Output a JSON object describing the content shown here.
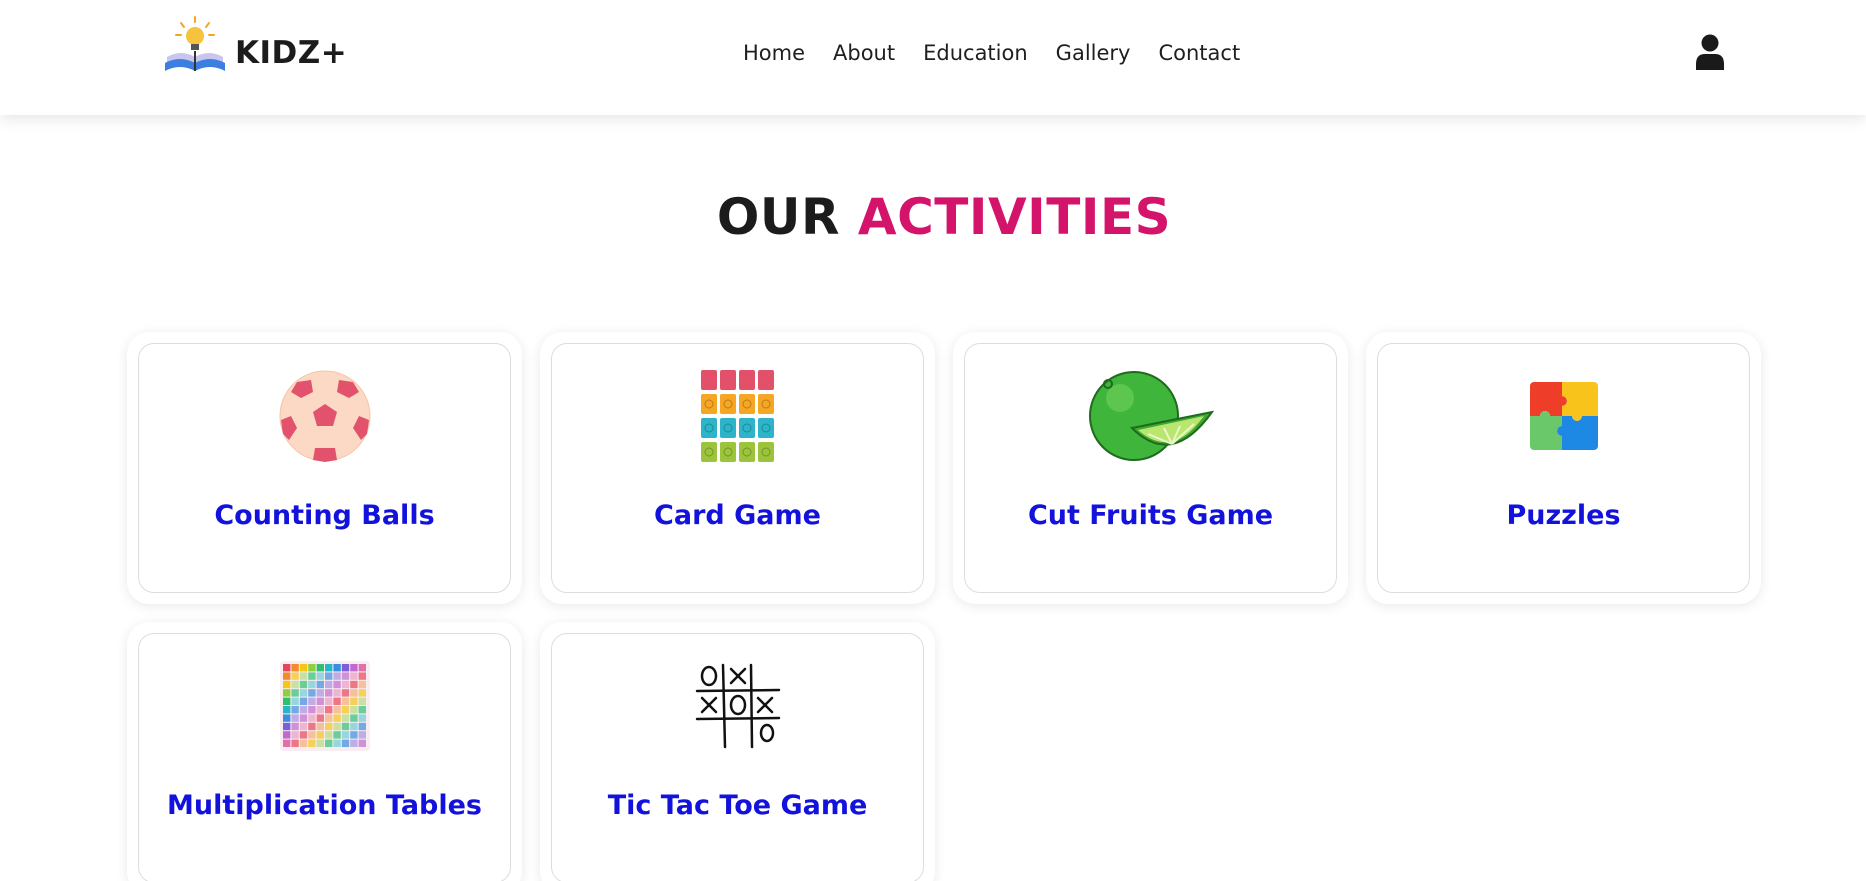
{
  "brand": {
    "name": "KIDZ+"
  },
  "nav": {
    "items": [
      {
        "label": "Home"
      },
      {
        "label": "About"
      },
      {
        "label": "Education"
      },
      {
        "label": "Gallery"
      },
      {
        "label": "Contact"
      }
    ]
  },
  "section": {
    "title_part1": "OUR",
    "title_part2": "ACTIVITIES"
  },
  "activities": [
    {
      "label": "Counting Balls",
      "icon": "soccer-ball-icon"
    },
    {
      "label": "Card Game",
      "icon": "memory-cards-icon"
    },
    {
      "label": "Cut Fruits Game",
      "icon": "lime-fruit-icon"
    },
    {
      "label": "Puzzles",
      "icon": "puzzle-pieces-icon"
    },
    {
      "label": "Multiplication Tables",
      "icon": "multiplication-table-icon"
    },
    {
      "label": "Tic Tac Toe Game",
      "icon": "tic-tac-toe-icon"
    }
  ],
  "colors": {
    "accent": "#d4136a",
    "card_label": "#1212dc",
    "text": "#1c1c1c"
  }
}
